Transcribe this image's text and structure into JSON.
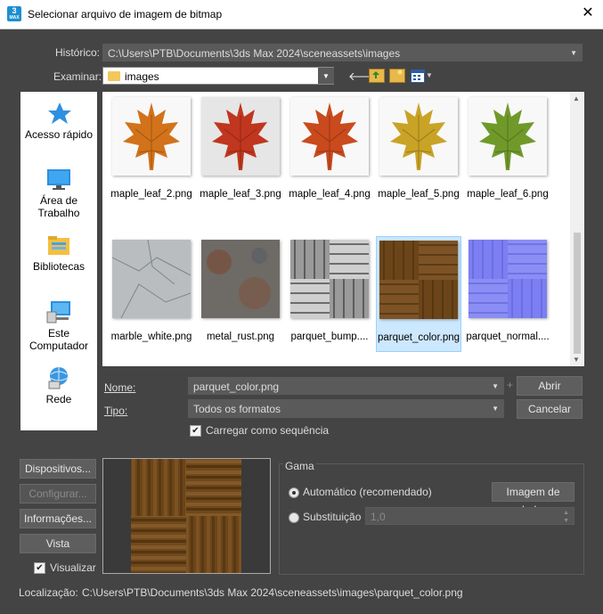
{
  "window": {
    "title": "Selecionar arquivo de imagem de bitmap",
    "close_glyph": "✕",
    "icon_text": "3",
    "icon_sub": "MAX"
  },
  "history": {
    "label": "Histórico:",
    "value": "C:\\Users\\PTB\\Documents\\3ds Max 2024\\sceneassets\\images"
  },
  "examine": {
    "label": "Examinar:",
    "value": "images"
  },
  "places": [
    {
      "label": "Acesso rápido",
      "icon": "star-icon"
    },
    {
      "label": "Área de Trabalho",
      "icon": "desktop-icon"
    },
    {
      "label": "Bibliotecas",
      "icon": "libraries-icon"
    },
    {
      "label": "Este Computador",
      "icon": "computer-icon"
    },
    {
      "label": "Rede",
      "icon": "network-icon"
    }
  ],
  "files": [
    {
      "name": "maple_leaf_2.png",
      "kind": "leaf",
      "color": "#d2721a"
    },
    {
      "name": "maple_leaf_3.png",
      "kind": "leaf",
      "color": "#c0361e"
    },
    {
      "name": "maple_leaf_4.png",
      "kind": "leaf",
      "color": "#c94a1d"
    },
    {
      "name": "maple_leaf_5.png",
      "kind": "leaf",
      "color": "#c9a326"
    },
    {
      "name": "maple_leaf_6.png",
      "kind": "leaf",
      "color": "#6f9a2a"
    },
    {
      "name": "marble_white.png",
      "kind": "marble",
      "color": "#b9bdbf"
    },
    {
      "name": "metal_rust.png",
      "kind": "rust",
      "color": "#6e6a66"
    },
    {
      "name": "parquet_bump....",
      "kind": "bump",
      "color": "#8a8a8a"
    },
    {
      "name": "parquet_color.png",
      "kind": "parquet",
      "color": "#6b4519",
      "selected": true
    },
    {
      "name": "parquet_normal....",
      "kind": "normal",
      "color": "#7b7ff2"
    }
  ],
  "name_field": {
    "label": "Nome:",
    "value": "parquet_color.png"
  },
  "type_field": {
    "label": "Tipo:",
    "value": "Todos os formatos"
  },
  "open_button": "Abrir",
  "cancel_button": "Cancelar",
  "sequence_checkbox": {
    "label": "Carregar como sequência",
    "checked": true
  },
  "side_buttons": {
    "devices": "Dispositivos...",
    "configure": "Configurar...",
    "info": "Informações...",
    "view": "Vista"
  },
  "visualize_checkbox": {
    "label": "Visualizar",
    "checked": true
  },
  "gamma": {
    "title": "Gama",
    "auto_label": "Automático (recomendado)",
    "image_data_button": "Imagem de dados",
    "override_label": "Substituição",
    "override_value": "1,0"
  },
  "location": {
    "label": "Localização:",
    "value": "C:\\Users\\PTB\\Documents\\3ds Max 2024\\sceneassets\\images\\parquet_color.png"
  }
}
